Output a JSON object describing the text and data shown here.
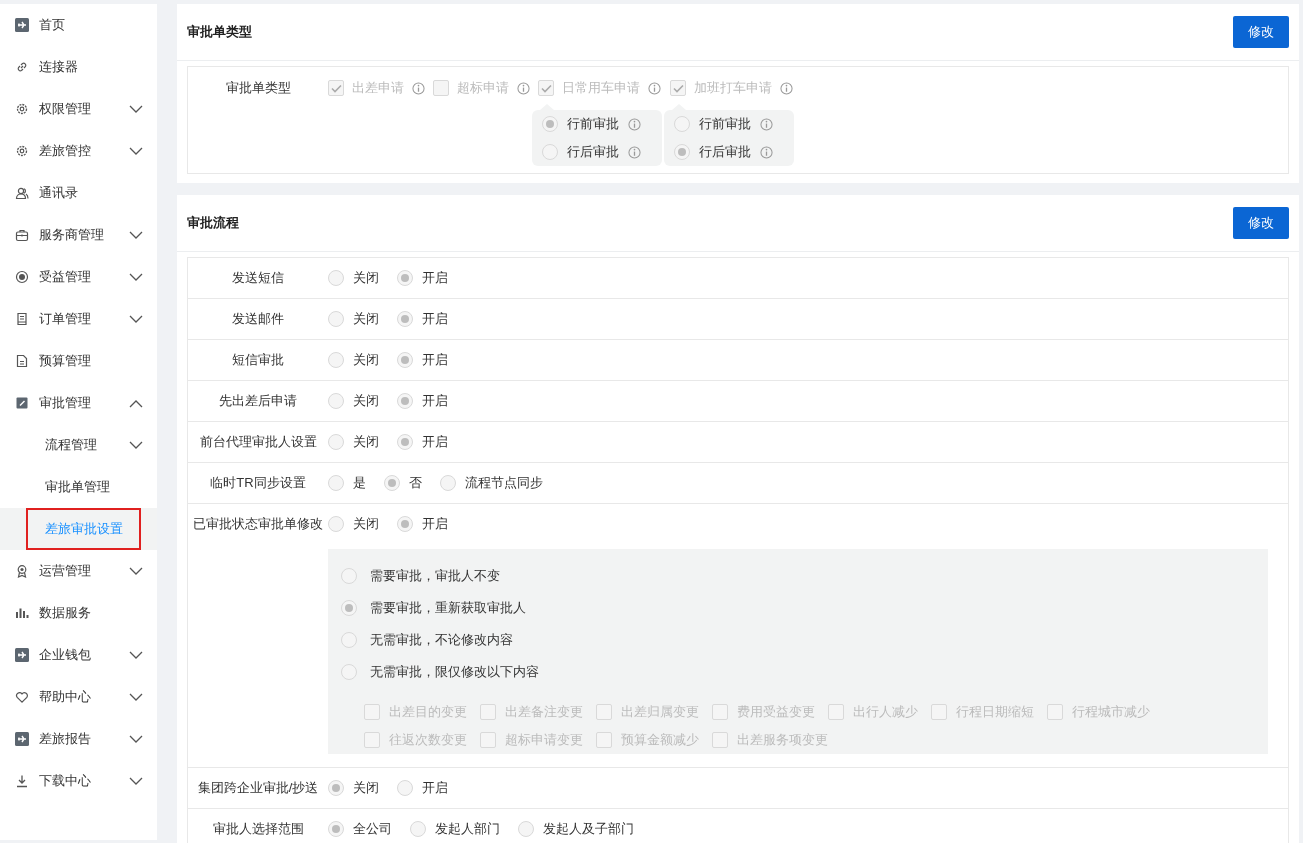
{
  "sidebar": {
    "items": [
      {
        "label": "首页",
        "kind": "plane"
      },
      {
        "label": "连接器",
        "kind": "link"
      },
      {
        "label": "权限管理",
        "kind": "gear",
        "expanded": false
      },
      {
        "label": "差旅管控",
        "kind": "gear",
        "expanded": false
      },
      {
        "label": "通讯录",
        "kind": "contacts"
      },
      {
        "label": "服务商管理",
        "kind": "case",
        "expanded": false
      },
      {
        "label": "受益管理",
        "kind": "coin",
        "expanded": false
      },
      {
        "label": "订单管理",
        "kind": "receipt",
        "expanded": false
      },
      {
        "label": "预算管理",
        "kind": "doc"
      },
      {
        "label": "审批管理",
        "kind": "edit",
        "expanded": true,
        "children": [
          {
            "label": "流程管理",
            "expanded": false,
            "selected": false
          },
          {
            "label": "审批单管理",
            "selected": false
          },
          {
            "label": "差旅审批设置",
            "selected": true
          }
        ]
      },
      {
        "label": "运营管理",
        "kind": "award",
        "expanded": false
      },
      {
        "label": "数据服务",
        "kind": "bars"
      },
      {
        "label": "企业钱包",
        "kind": "plane",
        "expanded": false
      },
      {
        "label": "帮助中心",
        "kind": "heart",
        "expanded": false
      },
      {
        "label": "差旅报告",
        "kind": "plane",
        "expanded": false
      },
      {
        "label": "下载中心",
        "kind": "download",
        "expanded": false
      }
    ]
  },
  "type_card": {
    "title": "审批单类型",
    "button": "修改",
    "field_label": "审批单类型",
    "options": [
      {
        "label": "出差申请",
        "checked": true,
        "disabled": true
      },
      {
        "label": "超标申请",
        "checked": false,
        "disabled": true
      },
      {
        "label": "日常用车申请",
        "checked": true,
        "disabled": true,
        "sub_options": [
          {
            "label": "行前审批",
            "selected": true
          },
          {
            "label": "行后审批",
            "selected": false
          }
        ]
      },
      {
        "label": "加班打车申请",
        "checked": true,
        "disabled": true,
        "sub_options": [
          {
            "label": "行前审批",
            "selected": false
          },
          {
            "label": "行后审批",
            "selected": true
          }
        ]
      }
    ]
  },
  "flow_card": {
    "title": "审批流程",
    "button": "修改",
    "rows": [
      {
        "label": "发送短信",
        "options": [
          {
            "label": "关闭",
            "selected": false
          },
          {
            "label": "开启",
            "selected": true
          }
        ]
      },
      {
        "label": "发送邮件",
        "options": [
          {
            "label": "关闭",
            "selected": false
          },
          {
            "label": "开启",
            "selected": true
          }
        ]
      },
      {
        "label": "短信审批",
        "options": [
          {
            "label": "关闭",
            "selected": false
          },
          {
            "label": "开启",
            "selected": true
          }
        ]
      },
      {
        "label": "先出差后申请",
        "options": [
          {
            "label": "关闭",
            "selected": false
          },
          {
            "label": "开启",
            "selected": true
          }
        ]
      },
      {
        "label": "前台代理审批人设置",
        "options": [
          {
            "label": "关闭",
            "selected": false
          },
          {
            "label": "开启",
            "selected": true
          }
        ]
      },
      {
        "label": "临时TR同步设置",
        "options": [
          {
            "label": "是",
            "selected": false
          },
          {
            "label": "否",
            "selected": true
          },
          {
            "label": "流程节点同步",
            "selected": false
          }
        ]
      },
      {
        "label": "已审批状态审批单修改",
        "options": [
          {
            "label": "关闭",
            "selected": false
          },
          {
            "label": "开启",
            "selected": true
          }
        ],
        "panel": {
          "options": [
            {
              "label": "需要审批，审批人不变",
              "selected": false
            },
            {
              "label": "需要审批，重新获取审批人",
              "selected": true
            },
            {
              "label": "无需审批，不论修改内容",
              "selected": false
            },
            {
              "label": "无需审批，限仅修改以下内容",
              "selected": false
            }
          ],
          "checkboxes": [
            {
              "label": "出差目的变更",
              "checked": false,
              "disabled": true
            },
            {
              "label": "出差备注变更",
              "checked": false,
              "disabled": true
            },
            {
              "label": "出差归属变更",
              "checked": false,
              "disabled": true
            },
            {
              "label": "费用受益变更",
              "checked": false,
              "disabled": true
            },
            {
              "label": "出行人减少",
              "checked": false,
              "disabled": true
            },
            {
              "label": "行程日期缩短",
              "checked": false,
              "disabled": true
            },
            {
              "label": "行程城市减少",
              "checked": false,
              "disabled": true
            },
            {
              "label": "往返次数变更",
              "checked": false,
              "disabled": true
            },
            {
              "label": "超标申请变更",
              "checked": false,
              "disabled": true
            },
            {
              "label": "预算金额减少",
              "checked": false,
              "disabled": true
            },
            {
              "label": "出差服务项变更",
              "checked": false,
              "disabled": true
            }
          ]
        }
      },
      {
        "label": "集团跨企业审批/抄送",
        "options": [
          {
            "label": "关闭",
            "selected": true
          },
          {
            "label": "开启",
            "selected": false
          }
        ]
      },
      {
        "label": "审批人选择范围",
        "options": [
          {
            "label": "全公司",
            "selected": true
          },
          {
            "label": "发起人部门",
            "selected": false
          },
          {
            "label": "发起人及子部门",
            "selected": false
          }
        ]
      }
    ]
  }
}
